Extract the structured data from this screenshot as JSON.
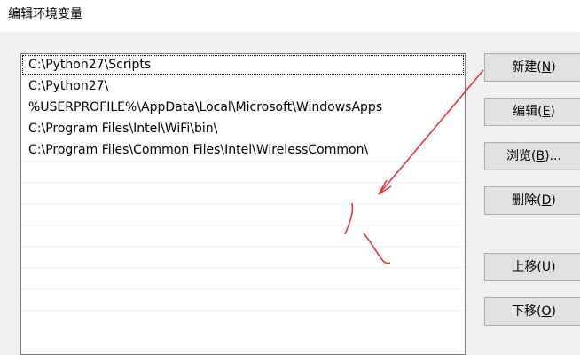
{
  "window": {
    "title": "编辑环境变量"
  },
  "paths": [
    "C:\\Python27\\Scripts",
    "C:\\Python27\\",
    "%USERPROFILE%\\AppData\\Local\\Microsoft\\WindowsApps",
    "C:\\Program Files\\Intel\\WiFi\\bin\\",
    "C:\\Program Files\\Common Files\\Intel\\WirelessCommon\\"
  ],
  "buttons": {
    "new": {
      "text": "新建(",
      "key": "N",
      "end": ")"
    },
    "edit": {
      "text": "编辑(",
      "key": "E",
      "end": ")"
    },
    "browse": {
      "text": "浏览(",
      "key": "B",
      "end": ")..."
    },
    "delete": {
      "text": "删除(",
      "key": "D",
      "end": ")"
    },
    "up": {
      "text": "上移(",
      "key": "U",
      "end": ")"
    },
    "down": {
      "text": "下移(",
      "key": "O",
      "end": ")"
    }
  },
  "annotation": {
    "color": "#e8323c"
  }
}
